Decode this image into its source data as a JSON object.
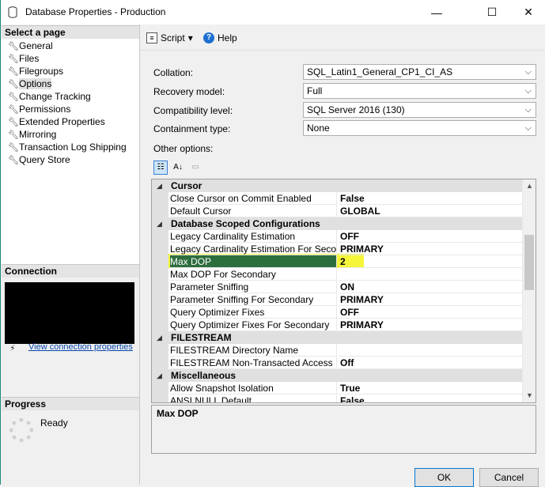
{
  "window": {
    "title": "Database Properties - Production",
    "controls": [
      "—",
      "☐",
      "✕"
    ]
  },
  "left": {
    "select_page_header": "Select a page",
    "pages": [
      {
        "label": "General"
      },
      {
        "label": "Files"
      },
      {
        "label": "Filegroups"
      },
      {
        "label": "Options",
        "selected": true
      },
      {
        "label": "Change Tracking"
      },
      {
        "label": "Permissions"
      },
      {
        "label": "Extended Properties"
      },
      {
        "label": "Mirroring"
      },
      {
        "label": "Transaction Log Shipping"
      },
      {
        "label": "Query Store"
      }
    ],
    "connection_header": "Connection",
    "view_connection_link": "View connection properties",
    "progress_header": "Progress",
    "progress_status": "Ready"
  },
  "toolbar": {
    "script_label": "Script",
    "script_dropdown": "▾",
    "help_label": "Help"
  },
  "form": {
    "collation_label": "Collation:",
    "collation_value": "SQL_Latin1_General_CP1_CI_AS",
    "recovery_label": "Recovery model:",
    "recovery_value": "Full",
    "compat_label": "Compatibility level:",
    "compat_value": "SQL Server 2016 (130)",
    "containment_label": "Containment type:",
    "containment_value": "None",
    "other_options_label": "Other options:"
  },
  "grid": {
    "rows": [
      {
        "type": "cat",
        "label": "Cursor"
      },
      {
        "type": "prop",
        "name": "Close Cursor on Commit Enabled",
        "value": "False"
      },
      {
        "type": "prop",
        "name": "Default Cursor",
        "value": "GLOBAL"
      },
      {
        "type": "cat",
        "label": "Database Scoped Configurations"
      },
      {
        "type": "prop",
        "name": "Legacy Cardinality Estimation",
        "value": "OFF"
      },
      {
        "type": "prop",
        "name": "Legacy Cardinality Estimation For Secondary",
        "value": "PRIMARY"
      },
      {
        "type": "prop",
        "name": "Max DOP",
        "value": "2",
        "selected": true
      },
      {
        "type": "prop",
        "name": "Max DOP For Secondary",
        "value": ""
      },
      {
        "type": "prop",
        "name": "Parameter Sniffing",
        "value": "ON"
      },
      {
        "type": "prop",
        "name": "Parameter Sniffing For Secondary",
        "value": "PRIMARY"
      },
      {
        "type": "prop",
        "name": "Query Optimizer Fixes",
        "value": "OFF"
      },
      {
        "type": "prop",
        "name": "Query Optimizer Fixes For Secondary",
        "value": "PRIMARY"
      },
      {
        "type": "cat",
        "label": "FILESTREAM"
      },
      {
        "type": "prop",
        "name": "FILESTREAM Directory Name",
        "value": ""
      },
      {
        "type": "prop",
        "name": "FILESTREAM Non-Transacted Access",
        "value": "Off"
      },
      {
        "type": "cat",
        "label": "Miscellaneous"
      },
      {
        "type": "prop",
        "name": "Allow Snapshot Isolation",
        "value": "True"
      },
      {
        "type": "prop",
        "name": "ANSI NULL Default",
        "value": "False"
      }
    ],
    "description": "Max DOP"
  },
  "buttons": {
    "ok": "OK",
    "cancel": "Cancel"
  },
  "colors": {
    "selected_row": "#2e6e3e",
    "highlight": "#f5f53a",
    "link": "#0645ad"
  }
}
